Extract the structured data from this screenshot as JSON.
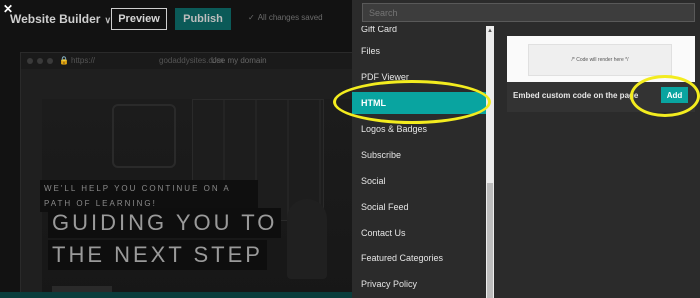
{
  "editor": {
    "close_icon": "✕",
    "title": "Website Builder",
    "title_chevron": "∨",
    "preview_label": "Preview",
    "publish_label": "Publish",
    "save_status": "All changes saved",
    "save_check": "✓",
    "browser": {
      "lock": "🔒",
      "url_scheme": "https://",
      "url_domain": "godaddysites.com",
      "use_domain_link": "Use my domain"
    },
    "hero": {
      "tagline": "WE'LL HELP YOU CONTINUE ON A PATH OF LEARNING!",
      "headline_line1": "GUIDING YOU TO",
      "headline_line2": "THE NEXT STEP"
    }
  },
  "modal": {
    "search_placeholder": "Search",
    "section_items": [
      {
        "label": "Gift Card",
        "active": false
      },
      {
        "label": "Files",
        "active": false
      },
      {
        "label": "PDF Viewer",
        "active": false
      },
      {
        "label": "HTML",
        "active": true
      },
      {
        "label": "Logos & Badges",
        "active": false
      },
      {
        "label": "Subscribe",
        "active": false
      },
      {
        "label": "Social",
        "active": false
      },
      {
        "label": "Social Feed",
        "active": false
      },
      {
        "label": "Contact Us",
        "active": false
      },
      {
        "label": "Featured Categories",
        "active": false
      },
      {
        "label": "Privacy Policy",
        "active": false
      }
    ],
    "scroll_up": "▲",
    "card": {
      "preview_text": "/* Code will render here */",
      "description": "Embed custom code on the page",
      "add_label": "Add"
    }
  },
  "colors": {
    "accent": "#09a4a0",
    "annotation": "#f3ec1f",
    "modal_bg": "#2b2b2b"
  }
}
